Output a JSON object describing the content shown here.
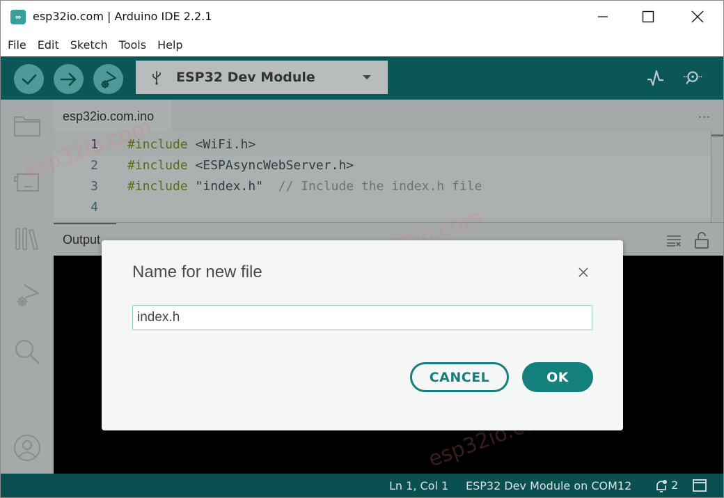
{
  "window": {
    "title": "esp32io.com | Arduino IDE 2.2.1",
    "app_icon": "arduino-infinity-icon",
    "controls": [
      "minimize",
      "maximize",
      "close"
    ]
  },
  "menu": {
    "items": [
      {
        "label": "File"
      },
      {
        "label": "Edit"
      },
      {
        "label": "Sketch"
      },
      {
        "label": "Tools"
      },
      {
        "label": "Help"
      }
    ]
  },
  "toolbar": {
    "verify_icon": "check-icon",
    "upload_icon": "arrow-right-icon",
    "debug_icon": "debug-play-icon",
    "board": {
      "icon": "usb-icon",
      "label": "ESP32 Dev Module"
    },
    "serial_plotter_icon": "pulse-icon",
    "serial_monitor_icon": "magnifier-dots-icon"
  },
  "sidebar": {
    "items": [
      {
        "name": "sketchbook",
        "icon": "folder-icon"
      },
      {
        "name": "boards-manager",
        "icon": "board-icon"
      },
      {
        "name": "library-manager",
        "icon": "library-icon"
      },
      {
        "name": "debug",
        "icon": "debug-icon"
      },
      {
        "name": "search",
        "icon": "search-icon"
      },
      {
        "name": "account",
        "icon": "user-icon"
      }
    ]
  },
  "editor": {
    "tab": {
      "label": "esp32io.com.ino"
    },
    "more_label": "...",
    "lines": [
      {
        "num": "1",
        "keyword": "#include",
        "rest": " <WiFi.h>",
        "comment": ""
      },
      {
        "num": "2",
        "keyword": "#include",
        "rest": " <ESPAsyncWebServer.h>",
        "comment": ""
      },
      {
        "num": "3",
        "keyword": "#include",
        "rest": " \"index.h\"",
        "comment": "  // Include the index.h file"
      },
      {
        "num": "4",
        "keyword": "",
        "rest": "",
        "comment": ""
      }
    ]
  },
  "output": {
    "label": "Output",
    "clear_icon": "clear-output-icon",
    "lock_icon": "unlock-icon"
  },
  "dialog": {
    "title": "Name for new file",
    "input_value": "index.h",
    "cancel_label": "CANCEL",
    "ok_label": "OK"
  },
  "statusbar": {
    "position": "Ln 1, Col 1",
    "board": "ESP32 Dev Module on COM12",
    "notifications": "2"
  },
  "watermark": "esp32io.com",
  "colors": {
    "toolbar_bg": "#0b5656",
    "accent": "#13807e",
    "statusbar_bg": "#0b5050"
  }
}
